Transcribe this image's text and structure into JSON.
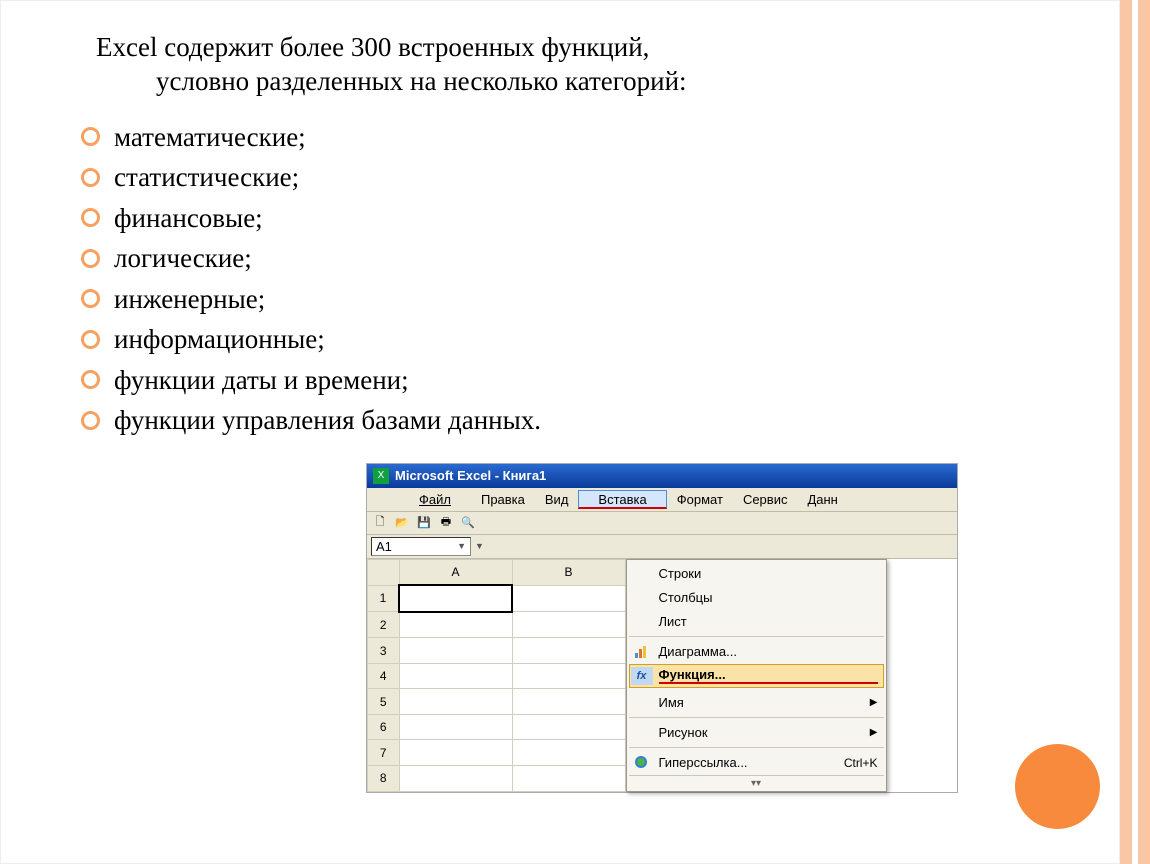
{
  "intro_line1": "Excel содержит более 300 встроенных функций,",
  "intro_line2": "условно разделенных на несколько категорий:",
  "categories": [
    "математические;",
    "статистические;",
    "финансовые;",
    "логические;",
    "инженерные;",
    "информационные;",
    "функции даты и времени;",
    "функции управления базами данных."
  ],
  "excel": {
    "title": "Microsoft Excel - Книга1",
    "menu": {
      "file": "Файл",
      "edit": "Правка",
      "view": "Вид",
      "insert": "Вставка",
      "format": "Формат",
      "tools": "Сервис",
      "data": "Данн"
    },
    "namebox_value": "A1",
    "columns": [
      "A",
      "B"
    ],
    "rows": [
      "1",
      "2",
      "3",
      "4",
      "5",
      "6",
      "7",
      "8"
    ],
    "context_menu": {
      "rows_lbl": "Строки",
      "cols_lbl": "Столбцы",
      "sheet_lbl": "Лист",
      "chart_lbl": "Диаграмма...",
      "function_lbl": "Функция...",
      "name_lbl": "Имя",
      "picture_lbl": "Рисунок",
      "hyperlink_lbl": "Гиперссылка...",
      "hyperlink_shortcut": "Ctrl+K",
      "fx_icon": "fx"
    }
  }
}
